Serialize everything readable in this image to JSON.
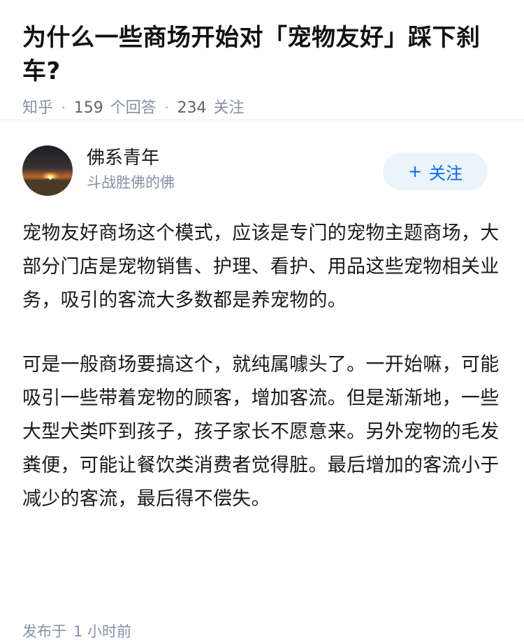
{
  "question": {
    "title": "为什么一些商场开始对「宠物友好」踩下刹车?",
    "source": "知乎",
    "answers_count": "159",
    "answers_label": "个回答",
    "followers_count": "234",
    "followers_label": "关注"
  },
  "author": {
    "name": "佛系青年",
    "bio": "斗战胜佛的佛",
    "avatar_icon": "sunset-avatar-icon",
    "follow_label": "关注",
    "follow_icon": "plus-icon"
  },
  "answer": {
    "paragraphs": [
      "宠物友好商场这个模式，应该是专门的宠物主题商场，大部分门店是宠物销售、护理、看护、用品这些宠物相关业务，吸引的客流大多数都是养宠物的。",
      "可是一般商场要搞这个，就纯属噱头了。一开始嘛，可能吸引一些带着宠物的顾客，增加客流。但是渐渐地，一些大型犬类吓到孩子，孩子家长不愿意来。另外宠物的毛发粪便，可能让餐饮类消费者觉得脏。最后增加的客流小于减少的客流，最后得不偿失。"
    ],
    "published_label": "发布于",
    "published_time": "1 小时前"
  },
  "colors": {
    "meta_gray": "#8590a6",
    "accent_blue": "#0066ff",
    "follow_bg": "#ebf3fb"
  }
}
